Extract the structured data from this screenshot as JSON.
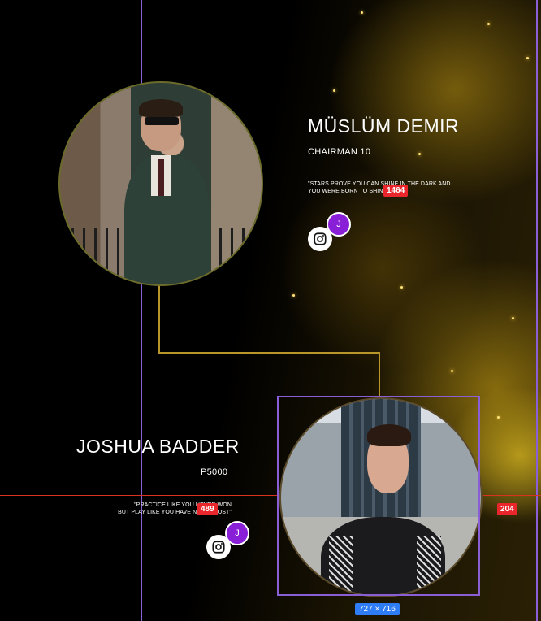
{
  "colors": {
    "accent_gold": "#b9962a",
    "guide_purple": "#8a5fd6",
    "guide_red": "#d8331f",
    "badge_red": "#e8262b",
    "badge_blue": "#2f7df6",
    "avatar_purple": "#8a1fd8"
  },
  "profiles": [
    {
      "name": "MÜSLÜM DEMIR",
      "role": "CHAIRMAN 10",
      "quote_line1": "\"STARS PROVE YOU CAN SHINE IN THE DARK AND",
      "quote_line2": "YOU WERE BORN TO SHINE.\"",
      "instagram_icon": "instagram-icon",
      "avatar_letter": "J"
    },
    {
      "name": "JOSHUA BADDER",
      "role": "P5000",
      "quote_line1": "\"PRACTICE LIKE YOU NEVER WON",
      "quote_line2": "BUT PLAY LIKE YOU HAVE NEVER LOST\"",
      "instagram_icon": "instagram-icon",
      "avatar_letter": "J"
    }
  ],
  "measurements": {
    "badge_top": "1464",
    "badge_left": "489",
    "badge_right": "204",
    "selection_size": "727 × 716"
  }
}
